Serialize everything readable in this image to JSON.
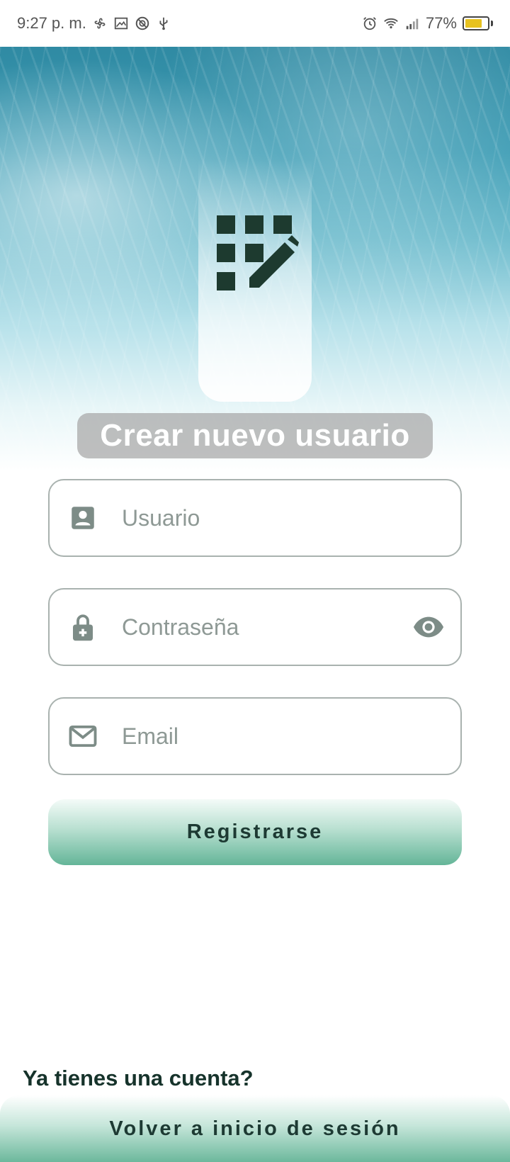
{
  "status_bar": {
    "time": "9:27 p. m.",
    "battery_percent": "77%",
    "left_icons": [
      "fan-icon",
      "gallery-icon",
      "vpn-icon",
      "usb-icon"
    ],
    "right_icons": [
      "alarm-icon",
      "wifi-icon",
      "signal-icon",
      "battery-icon"
    ]
  },
  "header": {
    "title": "Crear nuevo usuario",
    "logo_icon": "grid-edit-icon"
  },
  "form": {
    "username": {
      "placeholder": "Usuario",
      "value": "",
      "icon": "account-box-icon"
    },
    "password": {
      "placeholder": "Contraseña",
      "value": "",
      "icon": "lock-plus-icon",
      "toggle_icon": "eye-icon"
    },
    "email": {
      "placeholder": "Email",
      "value": "",
      "icon": "mail-icon"
    },
    "submit_label": "Registrarse"
  },
  "footer": {
    "question": "Ya tienes una cuenta?",
    "back_label": "Volver a inicio de sesión"
  },
  "colors": {
    "accent": "#64b598",
    "dark_text": "#16332b",
    "logo": "#1d3a2f",
    "field_icon": "#7d8c87"
  }
}
